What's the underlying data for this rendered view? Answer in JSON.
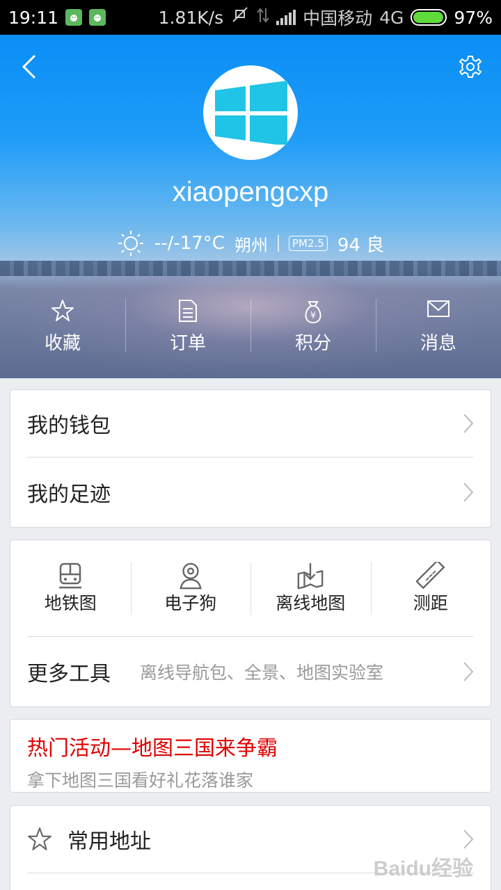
{
  "status_bar": {
    "time": "19:11",
    "speed": "1.81K/s",
    "carrier": "中国移动",
    "network": "4G",
    "battery": "97%",
    "battery_level": 0.97
  },
  "header": {
    "username": "xiaopengcxp",
    "weather": {
      "temp": "--/-17°C",
      "city": "朔州",
      "pm_label": "PM2.5",
      "aqi": "94 良"
    },
    "quick_actions": [
      {
        "label": "收藏",
        "icon": "star-icon"
      },
      {
        "label": "订单",
        "icon": "document-icon"
      },
      {
        "label": "积分",
        "icon": "money-bag-icon"
      },
      {
        "label": "消息",
        "icon": "envelope-icon"
      }
    ]
  },
  "wallet_card": {
    "items": [
      "我的钱包",
      "我的足迹"
    ]
  },
  "tools_card": {
    "tools": [
      {
        "label": "地铁图",
        "icon": "subway-icon"
      },
      {
        "label": "电子狗",
        "icon": "camera-icon"
      },
      {
        "label": "离线地图",
        "icon": "offline-map-icon"
      },
      {
        "label": "测距",
        "icon": "ruler-icon"
      }
    ],
    "more_title": "更多工具",
    "more_desc": "离线导航包、全景、地图实验室"
  },
  "promo": {
    "title": "热门活动—地图三国来争霸",
    "subtitle": "拿下地图三国看好礼花落谁家"
  },
  "address_card": {
    "label": "常用地址"
  },
  "watermark": "Baidu经验",
  "colors": {
    "accent_blue": "#1e9cf8",
    "promo_red": "#e00000",
    "windows_cyan": "#1fc4e6"
  }
}
